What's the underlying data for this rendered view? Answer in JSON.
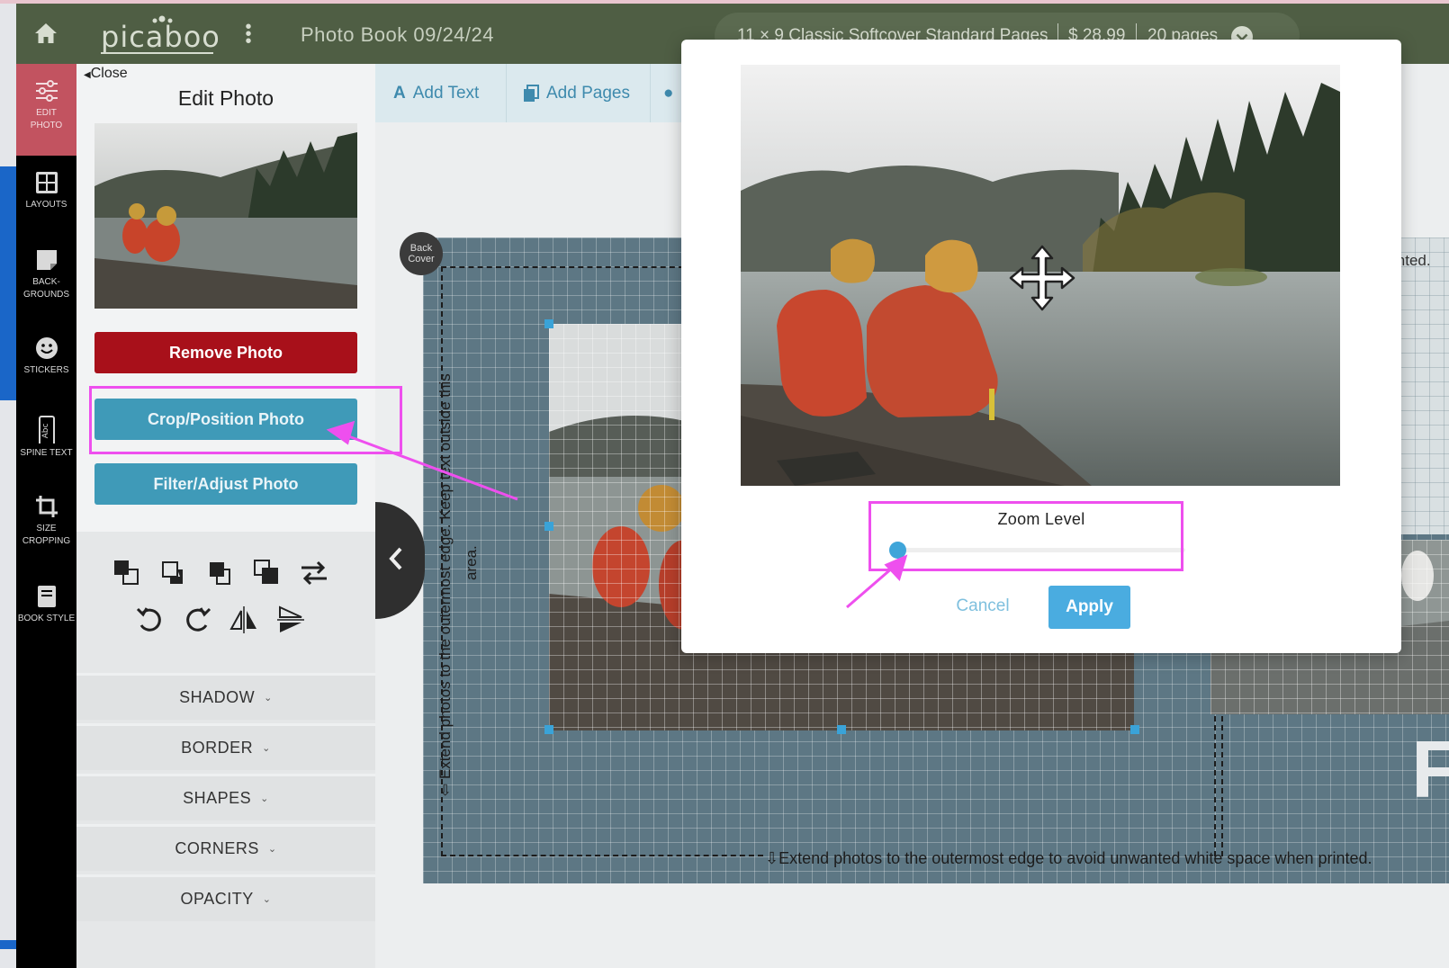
{
  "header": {
    "logo_text": "picaboo",
    "document_title": "Photo Book 09/24/24",
    "product": "11 × 9 Classic Softcover Standard Pages",
    "price": "$ 28.99",
    "pages": "20 pages"
  },
  "rail": {
    "items": [
      {
        "label_1": "EDIT",
        "label_2": "PHOTO"
      },
      {
        "label_1": "LAYOUTS",
        "label_2": ""
      },
      {
        "label_1": "BACK-",
        "label_2": "GROUNDS"
      },
      {
        "label_1": "STICKERS",
        "label_2": ""
      },
      {
        "label_1": "SPINE TEXT",
        "label_2": ""
      },
      {
        "label_1": "SIZE",
        "label_2": "CROPPING"
      },
      {
        "label_1": "BOOK STYLE",
        "label_2": ""
      }
    ]
  },
  "panel": {
    "close_label": "Close",
    "title": "Edit Photo",
    "remove_label": "Remove Photo",
    "crop_label": "Crop/Position Photo",
    "filter_label": "Filter/Adjust Photo",
    "accordions": [
      "SHADOW",
      "BORDER",
      "SHAPES",
      "CORNERS",
      "OPACITY"
    ]
  },
  "toolbar": {
    "add_text": "Add Text",
    "add_pages": "Add Pages"
  },
  "canvas": {
    "back_cover_1": "Back",
    "back_cover_2": "Cover",
    "vertical_hint_1": "Extend photos to the outermost edge. Keep text outside this",
    "vertical_hint_2": "area.",
    "bottom_hint": "Extend photos to the outermost edge to avoid unwanted white space when printed.",
    "right_fragment": "inted.",
    "big_letter": "F"
  },
  "modal": {
    "zoom_label": "Zoom Level",
    "zoom_value": 0,
    "cancel_label": "Cancel",
    "apply_label": "Apply"
  },
  "colors": {
    "header": "#4f5e44",
    "accent_blue": "#3f9ab8",
    "remove_red": "#a8101a",
    "annotation": "#ee4fee"
  }
}
